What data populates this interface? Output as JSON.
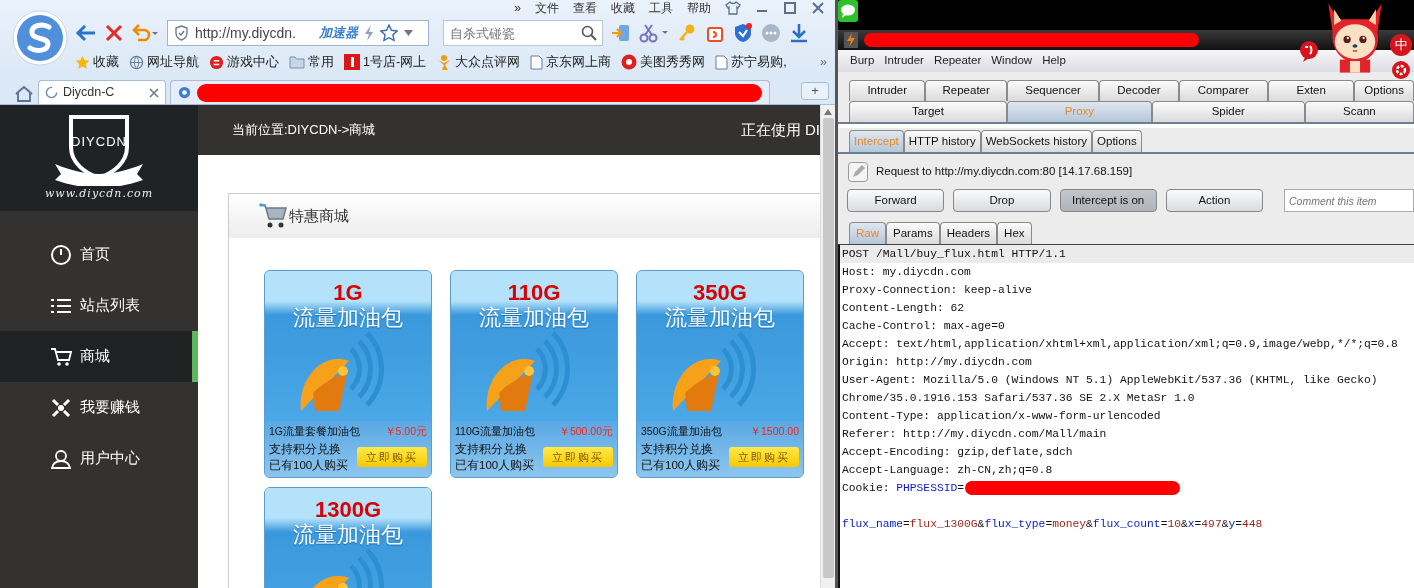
{
  "browser": {
    "menu": [
      "»",
      "文件",
      "查看",
      "收藏",
      "工具",
      "帮助"
    ],
    "address": {
      "value": "http://my.diycdn.",
      "accelerator": "加速器"
    },
    "search": {
      "placeholder": "自杀式碰瓷"
    },
    "bookmarks": [
      {
        "kind": "star",
        "label": "收藏"
      },
      {
        "kind": "globe",
        "label": "网址导航"
      },
      {
        "kind": "game",
        "label": "游戏中心"
      },
      {
        "kind": "folder",
        "label": "常用"
      },
      {
        "kind": "shop",
        "label": "1号店-网上"
      },
      {
        "kind": "person",
        "label": "大众点评网"
      },
      {
        "kind": "page",
        "label": "京东网上商"
      },
      {
        "kind": "meitu",
        "label": "美图秀秀网"
      },
      {
        "kind": "page",
        "label": "苏宁易购,"
      }
    ],
    "bookmarks_more": "»",
    "tabs": [
      {
        "kind": "page",
        "title": "Diycdn-C",
        "selected": true
      },
      {
        "kind": "redacted",
        "selected": false
      }
    ],
    "new_tab": "+"
  },
  "site": {
    "logo": {
      "name": "DIYCDN",
      "url": "www.diycdn.com"
    },
    "nav": [
      {
        "kind": "home",
        "label": "首页",
        "selected": false
      },
      {
        "kind": "list",
        "label": "站点列表",
        "selected": false
      },
      {
        "kind": "cart",
        "label": "商城",
        "selected": true
      },
      {
        "kind": "money",
        "label": "我要赚钱",
        "selected": false
      },
      {
        "kind": "user",
        "label": "用户中心",
        "selected": false
      }
    ],
    "breadcrumb": "当前位置:DIYCDN->商城",
    "status": "正在使用 DI",
    "panel_title": "特惠商城",
    "products": [
      {
        "size": "1G",
        "caption": "流量加油包",
        "name": "1G流量套餐加油包",
        "price": "￥5.00元",
        "points": "支持积分兑换",
        "sold": "已有100人购买",
        "button": "立即购买"
      },
      {
        "size": "110G",
        "caption": "流量加油包",
        "name": "110G流量加油包",
        "price": "￥500.00元",
        "points": "支持积分兑换",
        "sold": "已有100人购买",
        "button": "立即购买"
      },
      {
        "size": "350G",
        "caption": "流量加油包",
        "name": "350G流量加油包",
        "price": "￥1500.00",
        "points": "支持积分兑换",
        "sold": "已有100人购买",
        "button": "立即购买"
      },
      {
        "size": "1300G",
        "caption": "流量加油包"
      }
    ]
  },
  "burp": {
    "menu": [
      "Burp",
      "Intruder",
      "Repeater",
      "Window",
      "Help"
    ],
    "overlay": {
      "ime": "中"
    },
    "tabs_row1": [
      {
        "label": "Intruder",
        "selected": false
      },
      {
        "label": "Repeater",
        "selected": false
      },
      {
        "label": "Sequencer",
        "selected": false
      },
      {
        "label": "Decoder",
        "selected": false
      },
      {
        "label": "Comparer",
        "selected": false
      },
      {
        "label": "Exten",
        "selected": false
      },
      {
        "label": "Options",
        "selected": false
      }
    ],
    "tabs_row2": [
      {
        "label": "Target",
        "selected": false
      },
      {
        "label": "Proxy",
        "selected": true
      },
      {
        "label": "Spider",
        "selected": false
      },
      {
        "label": "Scann",
        "selected": false
      }
    ],
    "proxy_tabs": [
      {
        "label": "Intercept",
        "selected": true
      },
      {
        "label": "HTTP history",
        "selected": false
      },
      {
        "label": "WebSockets history",
        "selected": false
      },
      {
        "label": "Options",
        "selected": false
      }
    ],
    "request_to": "Request to http://my.diycdn.com:80  [14.17.68.159]",
    "buttons": [
      {
        "label": "Forward",
        "pressed": false
      },
      {
        "label": "Drop",
        "pressed": false
      },
      {
        "label": "Intercept is on",
        "pressed": true
      },
      {
        "label": "Action",
        "pressed": false
      }
    ],
    "comment": {
      "placeholder": "Comment this item"
    },
    "view_tabs": [
      {
        "label": "Raw",
        "selected": true
      },
      {
        "label": "Params",
        "selected": false
      },
      {
        "label": "Headers",
        "selected": false
      },
      {
        "label": "Hex",
        "selected": false
      }
    ],
    "lines": [
      {
        "kind": "text",
        "current": true,
        "segments": [
          {
            "kind": "plain",
            "text": "POST /Mall/buy_flux.html HTTP/1.1"
          }
        ]
      },
      {
        "kind": "text",
        "current": false,
        "segments": [
          {
            "kind": "plain",
            "text": "Host: my.diycdn.com"
          }
        ]
      },
      {
        "kind": "text",
        "current": false,
        "segments": [
          {
            "kind": "plain",
            "text": "Proxy-Connection: keep-alive"
          }
        ]
      },
      {
        "kind": "text",
        "current": false,
        "segments": [
          {
            "kind": "plain",
            "text": "Content-Length: 62"
          }
        ]
      },
      {
        "kind": "text",
        "current": false,
        "segments": [
          {
            "kind": "plain",
            "text": "Cache-Control: max-age=0"
          }
        ]
      },
      {
        "kind": "text",
        "current": false,
        "segments": [
          {
            "kind": "plain",
            "text": "Accept: text/html,application/xhtml+xml,application/xml;q=0.9,image/webp,*/*;q=0.8"
          }
        ]
      },
      {
        "kind": "text",
        "current": false,
        "segments": [
          {
            "kind": "plain",
            "text": "Origin: http://my.diycdn.com"
          }
        ]
      },
      {
        "kind": "text",
        "current": false,
        "segments": [
          {
            "kind": "plain",
            "text": "User-Agent: Mozilla/5.0 (Windows NT 5.1) AppleWebKit/537.36 (KHTML, like Gecko)"
          }
        ]
      },
      {
        "kind": "text",
        "current": false,
        "segments": [
          {
            "kind": "plain",
            "text": "Chrome/35.0.1916.153 Safari/537.36 SE 2.X MetaSr 1.0"
          }
        ]
      },
      {
        "kind": "text",
        "current": false,
        "segments": [
          {
            "kind": "plain",
            "text": "Content-Type: application/x-www-form-urlencoded"
          }
        ]
      },
      {
        "kind": "text",
        "current": false,
        "segments": [
          {
            "kind": "plain",
            "text": "Referer: http://my.diycdn.com/Mall/main"
          }
        ]
      },
      {
        "kind": "text",
        "current": false,
        "segments": [
          {
            "kind": "plain",
            "text": "Accept-Encoding: gzip,deflate,sdch"
          }
        ]
      },
      {
        "kind": "text",
        "current": false,
        "segments": [
          {
            "kind": "plain",
            "text": "Accept-Language: zh-CN,zh;q=0.8"
          }
        ]
      },
      {
        "kind": "text",
        "current": false,
        "segments": [
          {
            "kind": "plain",
            "text": "Cookie: "
          },
          {
            "kind": "key",
            "text": "PHPSESSID"
          },
          {
            "kind": "plain",
            "text": "="
          },
          {
            "kind": "redacted"
          }
        ]
      },
      {
        "kind": "blank",
        "current": false
      },
      {
        "kind": "text",
        "current": false,
        "segments": [
          {
            "kind": "key",
            "text": "flux_name"
          },
          {
            "kind": "plain",
            "text": "="
          },
          {
            "kind": "value",
            "text": "flux_1300G"
          },
          {
            "kind": "plain",
            "text": "&"
          },
          {
            "kind": "key",
            "text": "flux_type"
          },
          {
            "kind": "plain",
            "text": "="
          },
          {
            "kind": "value",
            "text": "money"
          },
          {
            "kind": "plain",
            "text": "&"
          },
          {
            "kind": "key",
            "text": "flux_count"
          },
          {
            "kind": "plain",
            "text": "="
          },
          {
            "kind": "value",
            "text": "10"
          },
          {
            "kind": "plain",
            "text": "&"
          },
          {
            "kind": "key",
            "text": "x"
          },
          {
            "kind": "plain",
            "text": "="
          },
          {
            "kind": "value",
            "text": "497"
          },
          {
            "kind": "plain",
            "text": "&"
          },
          {
            "kind": "key",
            "text": "y"
          },
          {
            "kind": "plain",
            "text": "="
          },
          {
            "kind": "value",
            "text": "448"
          }
        ]
      }
    ]
  }
}
